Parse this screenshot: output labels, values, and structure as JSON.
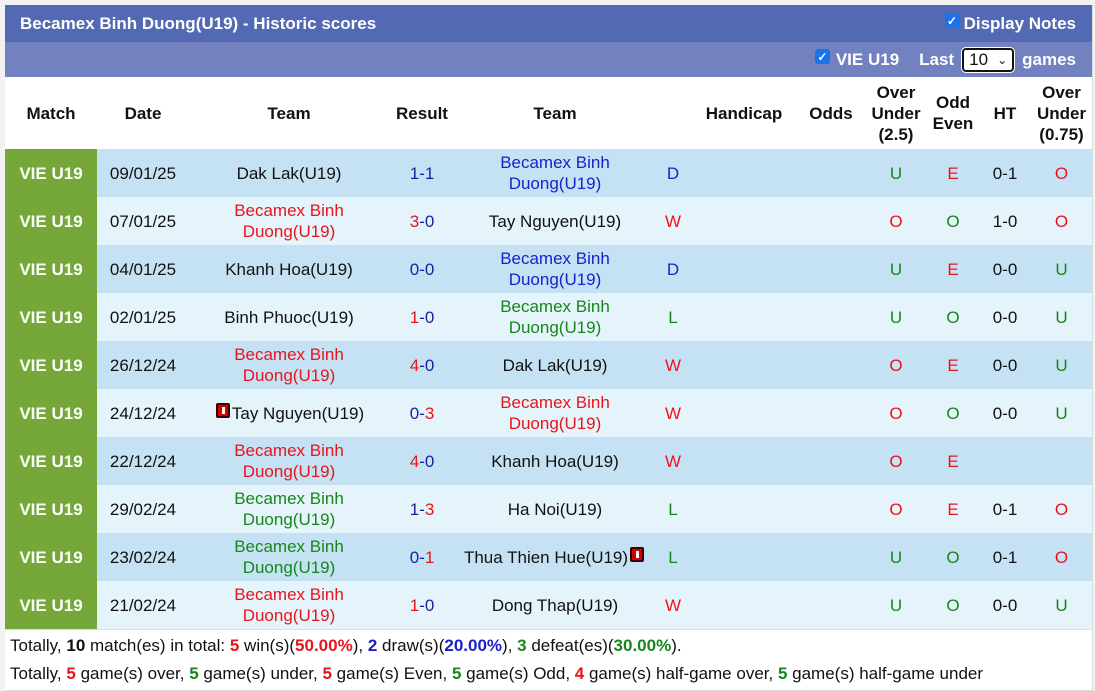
{
  "title": "Becamex Binh Duong(U19) - Historic scores",
  "display_notes": {
    "label": "Display Notes",
    "checked": true
  },
  "filter": {
    "league_label": "VIE U19",
    "league_checked": true,
    "last_label": "Last",
    "games_count": "10",
    "games_label": "games"
  },
  "columns": {
    "match": "Match",
    "date": "Date",
    "home": "Team",
    "result": "Result",
    "away": "Team",
    "handicap": "Handicap",
    "odds": "Odds",
    "ou25_1": "Over",
    "ou25_2": "Under",
    "ou25_3": "(2.5)",
    "oe_1": "Odd",
    "oe_2": "Even",
    "ht": "HT",
    "ou075_1": "Over",
    "ou075_2": "Under",
    "ou075_3": "(0.75)"
  },
  "colors": {
    "league_bg": "#75a838",
    "title_bg": "#5369b3",
    "filter_bg": "#7281c0",
    "row_a": "#c5e2f5",
    "row_b": "#e5f4fb",
    "win": "#e8141c",
    "draw": "#1a21c8",
    "loss": "#17861b"
  },
  "rows": [
    {
      "league": "VIE U19",
      "date": "09/01/25",
      "home": "Dak Lak(U19)",
      "home_color": "black",
      "home_card": false,
      "hs": "1",
      "as": "1",
      "hs_color": "blue-n",
      "as_color": "blue-n",
      "away": "Becamex Binh Duong(U19)",
      "away_color": "blue",
      "away_card": false,
      "wdl": "D",
      "wdl_color": "blue",
      "handicap": "",
      "odds": "",
      "ou": "U",
      "oe": "E",
      "ht": "0-1",
      "ou2": "O"
    },
    {
      "league": "VIE U19",
      "date": "07/01/25",
      "home": "Becamex Binh Duong(U19)",
      "home_color": "red",
      "home_card": false,
      "hs": "3",
      "as": "0",
      "hs_color": "red",
      "as_color": "blue-n",
      "away": "Tay Nguyen(U19)",
      "away_color": "black",
      "away_card": false,
      "wdl": "W",
      "wdl_color": "red",
      "handicap": "",
      "odds": "",
      "ou": "O",
      "oe": "O",
      "ht": "1-0",
      "ou2": "O"
    },
    {
      "league": "VIE U19",
      "date": "04/01/25",
      "home": "Khanh Hoa(U19)",
      "home_color": "black",
      "home_card": false,
      "hs": "0",
      "as": "0",
      "hs_color": "blue-n",
      "as_color": "blue-n",
      "away": "Becamex Binh Duong(U19)",
      "away_color": "blue",
      "away_card": false,
      "wdl": "D",
      "wdl_color": "blue",
      "handicap": "",
      "odds": "",
      "ou": "U",
      "oe": "E",
      "ht": "0-0",
      "ou2": "U"
    },
    {
      "league": "VIE U19",
      "date": "02/01/25",
      "home": "Binh Phuoc(U19)",
      "home_color": "black",
      "home_card": false,
      "hs": "1",
      "as": "0",
      "hs_color": "red",
      "as_color": "blue-n",
      "away": "Becamex Binh Duong(U19)",
      "away_color": "green",
      "away_card": false,
      "wdl": "L",
      "wdl_color": "green",
      "handicap": "",
      "odds": "",
      "ou": "U",
      "oe": "O",
      "ht": "0-0",
      "ou2": "U"
    },
    {
      "league": "VIE U19",
      "date": "26/12/24",
      "home": "Becamex Binh Duong(U19)",
      "home_color": "red",
      "home_card": false,
      "hs": "4",
      "as": "0",
      "hs_color": "red",
      "as_color": "blue-n",
      "away": "Dak Lak(U19)",
      "away_color": "black",
      "away_card": false,
      "wdl": "W",
      "wdl_color": "red",
      "handicap": "",
      "odds": "",
      "ou": "O",
      "oe": "E",
      "ht": "0-0",
      "ou2": "U"
    },
    {
      "league": "VIE U19",
      "date": "24/12/24",
      "home": "Tay Nguyen(U19)",
      "home_color": "black",
      "home_card": true,
      "hs": "0",
      "as": "3",
      "hs_color": "blue-n",
      "as_color": "red",
      "away": "Becamex Binh Duong(U19)",
      "away_color": "red",
      "away_card": false,
      "wdl": "W",
      "wdl_color": "red",
      "handicap": "",
      "odds": "",
      "ou": "O",
      "oe": "O",
      "ht": "0-0",
      "ou2": "U"
    },
    {
      "league": "VIE U19",
      "date": "22/12/24",
      "home": "Becamex Binh Duong(U19)",
      "home_color": "red",
      "home_card": false,
      "hs": "4",
      "as": "0",
      "hs_color": "red",
      "as_color": "blue-n",
      "away": "Khanh Hoa(U19)",
      "away_color": "black",
      "away_card": false,
      "wdl": "W",
      "wdl_color": "red",
      "handicap": "",
      "odds": "",
      "ou": "O",
      "oe": "E",
      "ht": "",
      "ou2": ""
    },
    {
      "league": "VIE U19",
      "date": "29/02/24",
      "home": "Becamex Binh Duong(U19)",
      "home_color": "green",
      "home_card": false,
      "hs": "1",
      "as": "3",
      "hs_color": "blue-n",
      "as_color": "red",
      "away": "Ha Noi(U19)",
      "away_color": "black",
      "away_card": false,
      "wdl": "L",
      "wdl_color": "green",
      "handicap": "",
      "odds": "",
      "ou": "O",
      "oe": "E",
      "ht": "0-1",
      "ou2": "O"
    },
    {
      "league": "VIE U19",
      "date": "23/02/24",
      "home": "Becamex Binh Duong(U19)",
      "home_color": "green",
      "home_card": false,
      "hs": "0",
      "as": "1",
      "hs_color": "blue-n",
      "as_color": "red",
      "away": "Thua Thien Hue(U19)",
      "away_color": "black",
      "away_card": true,
      "wdl": "L",
      "wdl_color": "green",
      "handicap": "",
      "odds": "",
      "ou": "U",
      "oe": "O",
      "ht": "0-1",
      "ou2": "O"
    },
    {
      "league": "VIE U19",
      "date": "21/02/24",
      "home": "Becamex Binh Duong(U19)",
      "home_color": "red",
      "home_card": false,
      "hs": "1",
      "as": "0",
      "hs_color": "red",
      "as_color": "blue-n",
      "away": "Dong Thap(U19)",
      "away_color": "black",
      "away_card": false,
      "wdl": "W",
      "wdl_color": "red",
      "handicap": "",
      "odds": "",
      "ou": "U",
      "oe": "O",
      "ht": "0-0",
      "ou2": "U"
    }
  ],
  "summary1": [
    {
      "t": "Totally, ",
      "c": ""
    },
    {
      "t": "10",
      "c": "b black"
    },
    {
      "t": " match(es) in total: ",
      "c": ""
    },
    {
      "t": "5",
      "c": "b red"
    },
    {
      "t": " win(s)(",
      "c": ""
    },
    {
      "t": "50.00%",
      "c": "b red"
    },
    {
      "t": "), ",
      "c": ""
    },
    {
      "t": "2",
      "c": "b blue"
    },
    {
      "t": " draw(s)(",
      "c": ""
    },
    {
      "t": "20.00%",
      "c": "b blue"
    },
    {
      "t": "), ",
      "c": ""
    },
    {
      "t": "3",
      "c": "b green"
    },
    {
      "t": " defeat(es)(",
      "c": ""
    },
    {
      "t": "30.00%",
      "c": "b green"
    },
    {
      "t": ").",
      "c": ""
    }
  ],
  "summary2": [
    {
      "t": "Totally, ",
      "c": ""
    },
    {
      "t": "5",
      "c": "b red"
    },
    {
      "t": " game(s) over, ",
      "c": ""
    },
    {
      "t": "5",
      "c": "b green"
    },
    {
      "t": " game(s) under, ",
      "c": ""
    },
    {
      "t": "5",
      "c": "b red"
    },
    {
      "t": " game(s) Even, ",
      "c": ""
    },
    {
      "t": "5",
      "c": "b green"
    },
    {
      "t": " game(s) Odd, ",
      "c": ""
    },
    {
      "t": "4",
      "c": "b red"
    },
    {
      "t": " game(s) half-game over, ",
      "c": ""
    },
    {
      "t": "5",
      "c": "b green"
    },
    {
      "t": " game(s) half-game under",
      "c": ""
    }
  ]
}
